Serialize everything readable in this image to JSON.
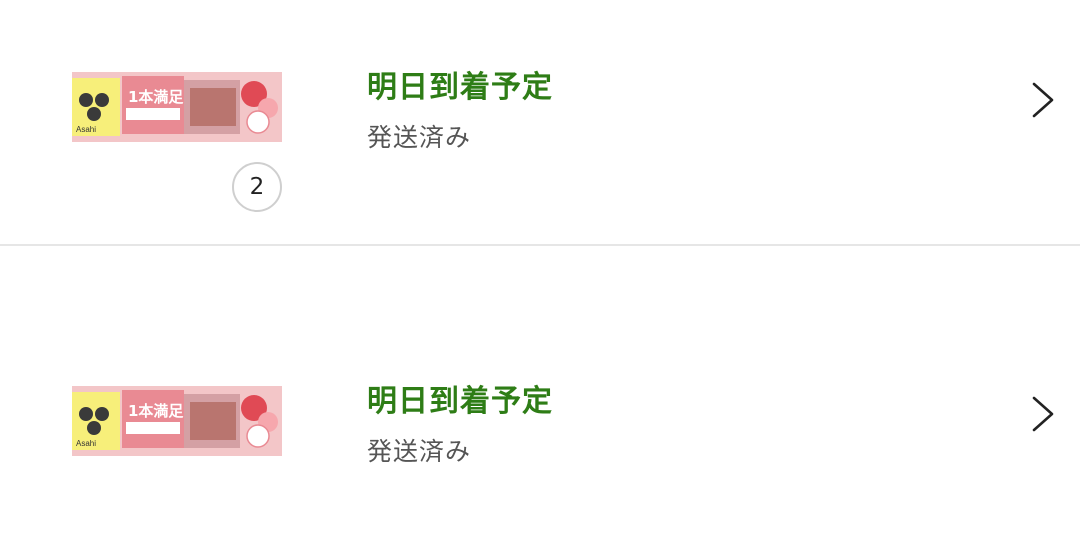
{
  "orders": [
    {
      "status_title": "明日到着予定",
      "status_sub": "発送済み",
      "quantity": "2",
      "product_image": "asahi-ippon-manzoku-bar-strawberry-package",
      "product_brand_text": "Asahi",
      "product_name_text": "1本満足",
      "chevron_icon": "chevron-right-icon"
    },
    {
      "status_title": "明日到着予定",
      "status_sub": "発送済み",
      "product_image": "asahi-ippon-manzoku-bar-strawberry-package",
      "product_brand_text": "Asahi",
      "product_name_text": "1本満足",
      "chevron_icon": "chevron-right-icon"
    }
  ],
  "colors": {
    "status_green": "#2e7d16",
    "sub_text": "#555555",
    "divider": "#e6e6e6",
    "package_pink": "#e98a93",
    "package_yellow": "#f7ef7a"
  }
}
